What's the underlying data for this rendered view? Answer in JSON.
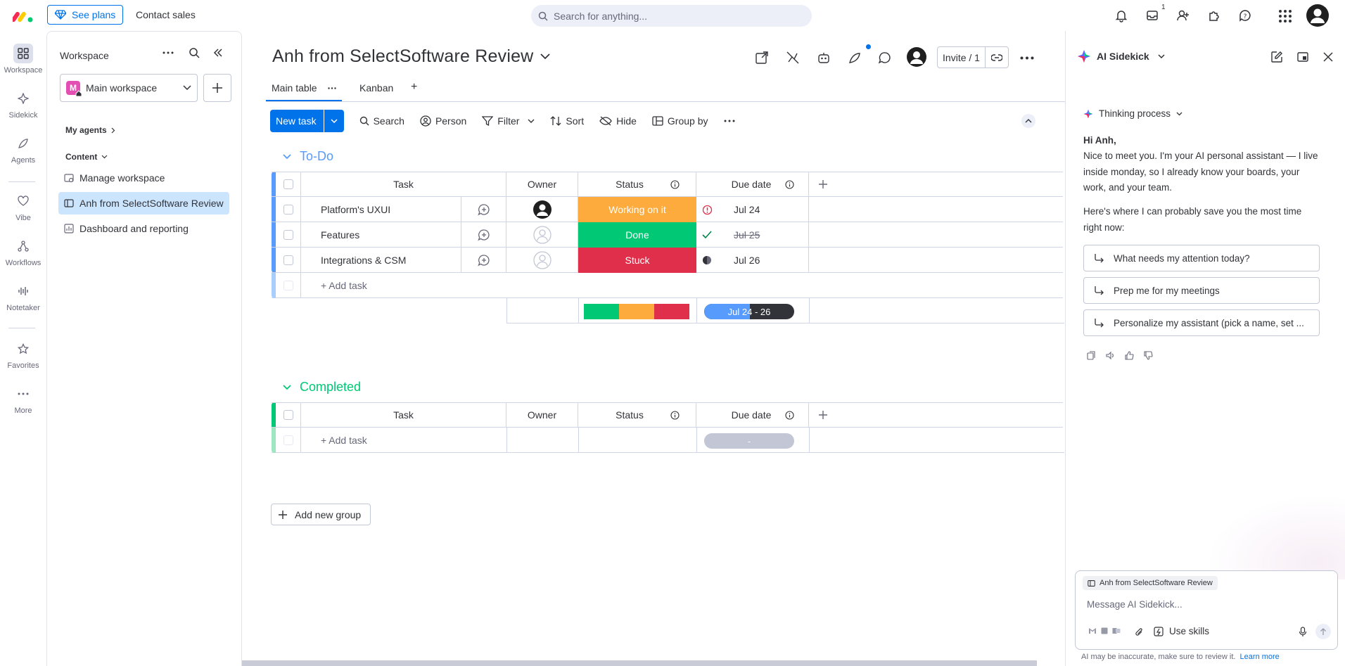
{
  "topbar": {
    "see_plans": "See plans",
    "contact_sales": "Contact sales",
    "search_placeholder": "Search for anything...",
    "inbox_badge": "1"
  },
  "rail": {
    "items": [
      {
        "label": "Workspace",
        "icon": "grid-icon"
      },
      {
        "label": "Sidekick",
        "icon": "sparkle-icon"
      },
      {
        "label": "Agents",
        "icon": "agent-icon"
      },
      {
        "label": "Vibe",
        "icon": "heart-icon"
      },
      {
        "label": "Workflows",
        "icon": "workflow-icon"
      },
      {
        "label": "Notetaker",
        "icon": "waveform-icon"
      },
      {
        "label": "Favorites",
        "icon": "star-icon"
      },
      {
        "label": "More",
        "icon": "more-icon"
      }
    ]
  },
  "workspace": {
    "title": "Workspace",
    "selected": "Main workspace",
    "badge_letter": "M",
    "my_agents": "My agents",
    "content": "Content",
    "items": [
      {
        "label": "Manage workspace"
      },
      {
        "label": "Anh from SelectSoftware Review"
      },
      {
        "label": "Dashboard and reporting"
      }
    ]
  },
  "board": {
    "title": "Anh from SelectSoftware Review",
    "invite": "Invite / 1",
    "tabs": [
      {
        "label": "Main table"
      },
      {
        "label": "Kanban"
      }
    ],
    "toolbar": {
      "new_task": "New task",
      "search": "Search",
      "person": "Person",
      "filter": "Filter",
      "sort": "Sort",
      "hide": "Hide",
      "group_by": "Group by"
    },
    "columns": {
      "task": "Task",
      "owner": "Owner",
      "status": "Status",
      "due": "Due date"
    },
    "groups": [
      {
        "title": "To-Do",
        "color": "#579bfc",
        "rows": [
          {
            "task": "Platform's UXUI",
            "status": "Working on it",
            "status_color": "#fdab3d",
            "due": "Jul 24"
          },
          {
            "task": "Features",
            "status": "Done",
            "status_color": "#00c875",
            "due": "Jul 25"
          },
          {
            "task": "Integrations & CSM",
            "status": "Stuck",
            "status_color": "#df2f4a",
            "due": "Jul 26"
          }
        ],
        "add_task": "+ Add task",
        "summary_range": "Jul 24 - 26"
      },
      {
        "title": "Completed",
        "color": "#00c875",
        "rows": [],
        "add_task": "+ Add task",
        "summary_range": "-"
      }
    ],
    "add_group": "Add new group"
  },
  "sidekick": {
    "title": "AI Sidekick",
    "thinking": "Thinking process",
    "greeting": "Hi Anh,",
    "intro": "Nice to meet you. I'm your AI personal assistant — I live inside monday, so I already know your boards, your work, and your team.",
    "lead": "Here's where I can probably save you the most time right now:",
    "suggestions": [
      {
        "label": "What needs my attention today?"
      },
      {
        "label": "Prep me for my meetings"
      },
      {
        "label": "Personalize my assistant (pick a name, set ..."
      }
    ],
    "context_chip": "Anh from SelectSoftware Review",
    "message_placeholder": "Message AI Sidekick...",
    "use_skills": "Use skills",
    "disclaimer": "AI may be inaccurate, make sure to review it.",
    "learn_more": "Learn more"
  }
}
